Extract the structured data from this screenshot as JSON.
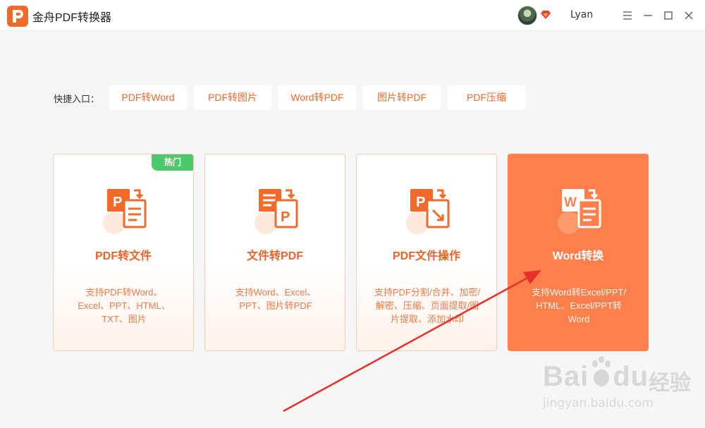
{
  "app": {
    "title": "金舟PDF转换器",
    "user_name": "Lyan",
    "accent_color": "#f16a2a"
  },
  "window_controls": [
    "menu-icon",
    "minimize-icon",
    "maximize-icon",
    "close-icon"
  ],
  "quick_entry": {
    "label": "快捷入口：",
    "buttons": [
      "PDF转Word",
      "PDF转图片",
      "Word转PDF",
      "图片转PDF",
      "PDF压缩"
    ]
  },
  "cards": [
    {
      "title": "PDF转文件",
      "badge": "热门",
      "icon": "pdf-to-file-icon",
      "desc": [
        "支持PDF转Word、",
        "Excel、PPT、HTML、",
        "TXT、图片"
      ]
    },
    {
      "title": "文件转PDF",
      "icon": "file-to-pdf-icon",
      "desc": [
        "支持Word、Excel、",
        "PPT、图片转PDF"
      ]
    },
    {
      "title": "PDF文件操作",
      "icon": "pdf-operations-icon",
      "desc": [
        "支持PDF分割/合并、加密/",
        "解密、压缩、页面提取/图",
        "片提取、添加水印"
      ]
    },
    {
      "title": "Word转换",
      "icon": "word-convert-icon",
      "state": "hovered",
      "desc": [
        "支持Word转Excel/PPT/",
        "HTML、Excel/PPT转",
        "Word"
      ]
    }
  ],
  "watermark": {
    "brand": "Bai",
    "brand_suffix": "du",
    "cn": "经验",
    "url": "jingyan.baidu.com"
  }
}
